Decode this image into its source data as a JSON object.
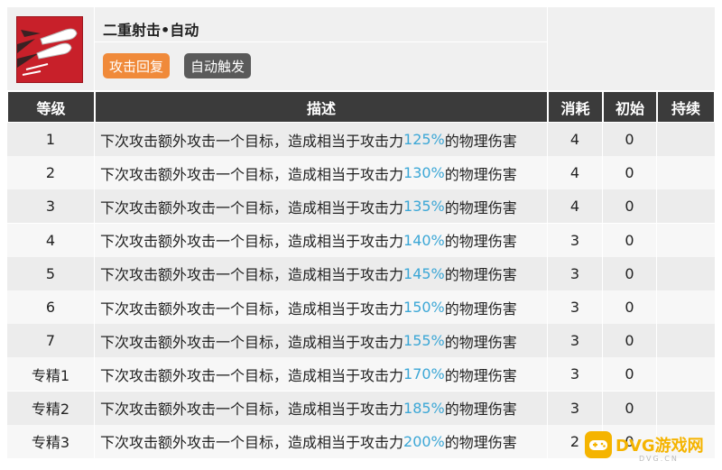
{
  "skill": {
    "name": "二重射击•自动",
    "tags": [
      {
        "label": "攻击回复",
        "color": "#f08a3a"
      },
      {
        "label": "自动触发",
        "color": "#5a5a5a"
      }
    ],
    "icon": "skill-bullets-icon"
  },
  "table": {
    "headers": [
      "等级",
      "描述",
      "消耗",
      "初始",
      "持续"
    ],
    "desc_prefix": "下次攻击额外攻击一个目标，造成相当于攻击力",
    "desc_suffix": "的物理伤害",
    "rows": [
      {
        "level": "1",
        "pct": "125%",
        "cost": "4",
        "init": "0",
        "dur": ""
      },
      {
        "level": "2",
        "pct": "130%",
        "cost": "4",
        "init": "0",
        "dur": ""
      },
      {
        "level": "3",
        "pct": "135%",
        "cost": "4",
        "init": "0",
        "dur": ""
      },
      {
        "level": "4",
        "pct": "140%",
        "cost": "3",
        "init": "0",
        "dur": ""
      },
      {
        "level": "5",
        "pct": "145%",
        "cost": "3",
        "init": "0",
        "dur": ""
      },
      {
        "level": "6",
        "pct": "150%",
        "cost": "3",
        "init": "0",
        "dur": ""
      },
      {
        "level": "7",
        "pct": "155%",
        "cost": "3",
        "init": "0",
        "dur": ""
      },
      {
        "level": "专精1",
        "pct": "170%",
        "cost": "3",
        "init": "0",
        "dur": ""
      },
      {
        "level": "专精2",
        "pct": "185%",
        "cost": "3",
        "init": "0",
        "dur": ""
      },
      {
        "level": "专精3",
        "pct": "200%",
        "cost": "2",
        "init": "0",
        "dur": ""
      }
    ]
  },
  "watermark": {
    "text": "DVG游戏网",
    "sub": "DVG.CN"
  }
}
